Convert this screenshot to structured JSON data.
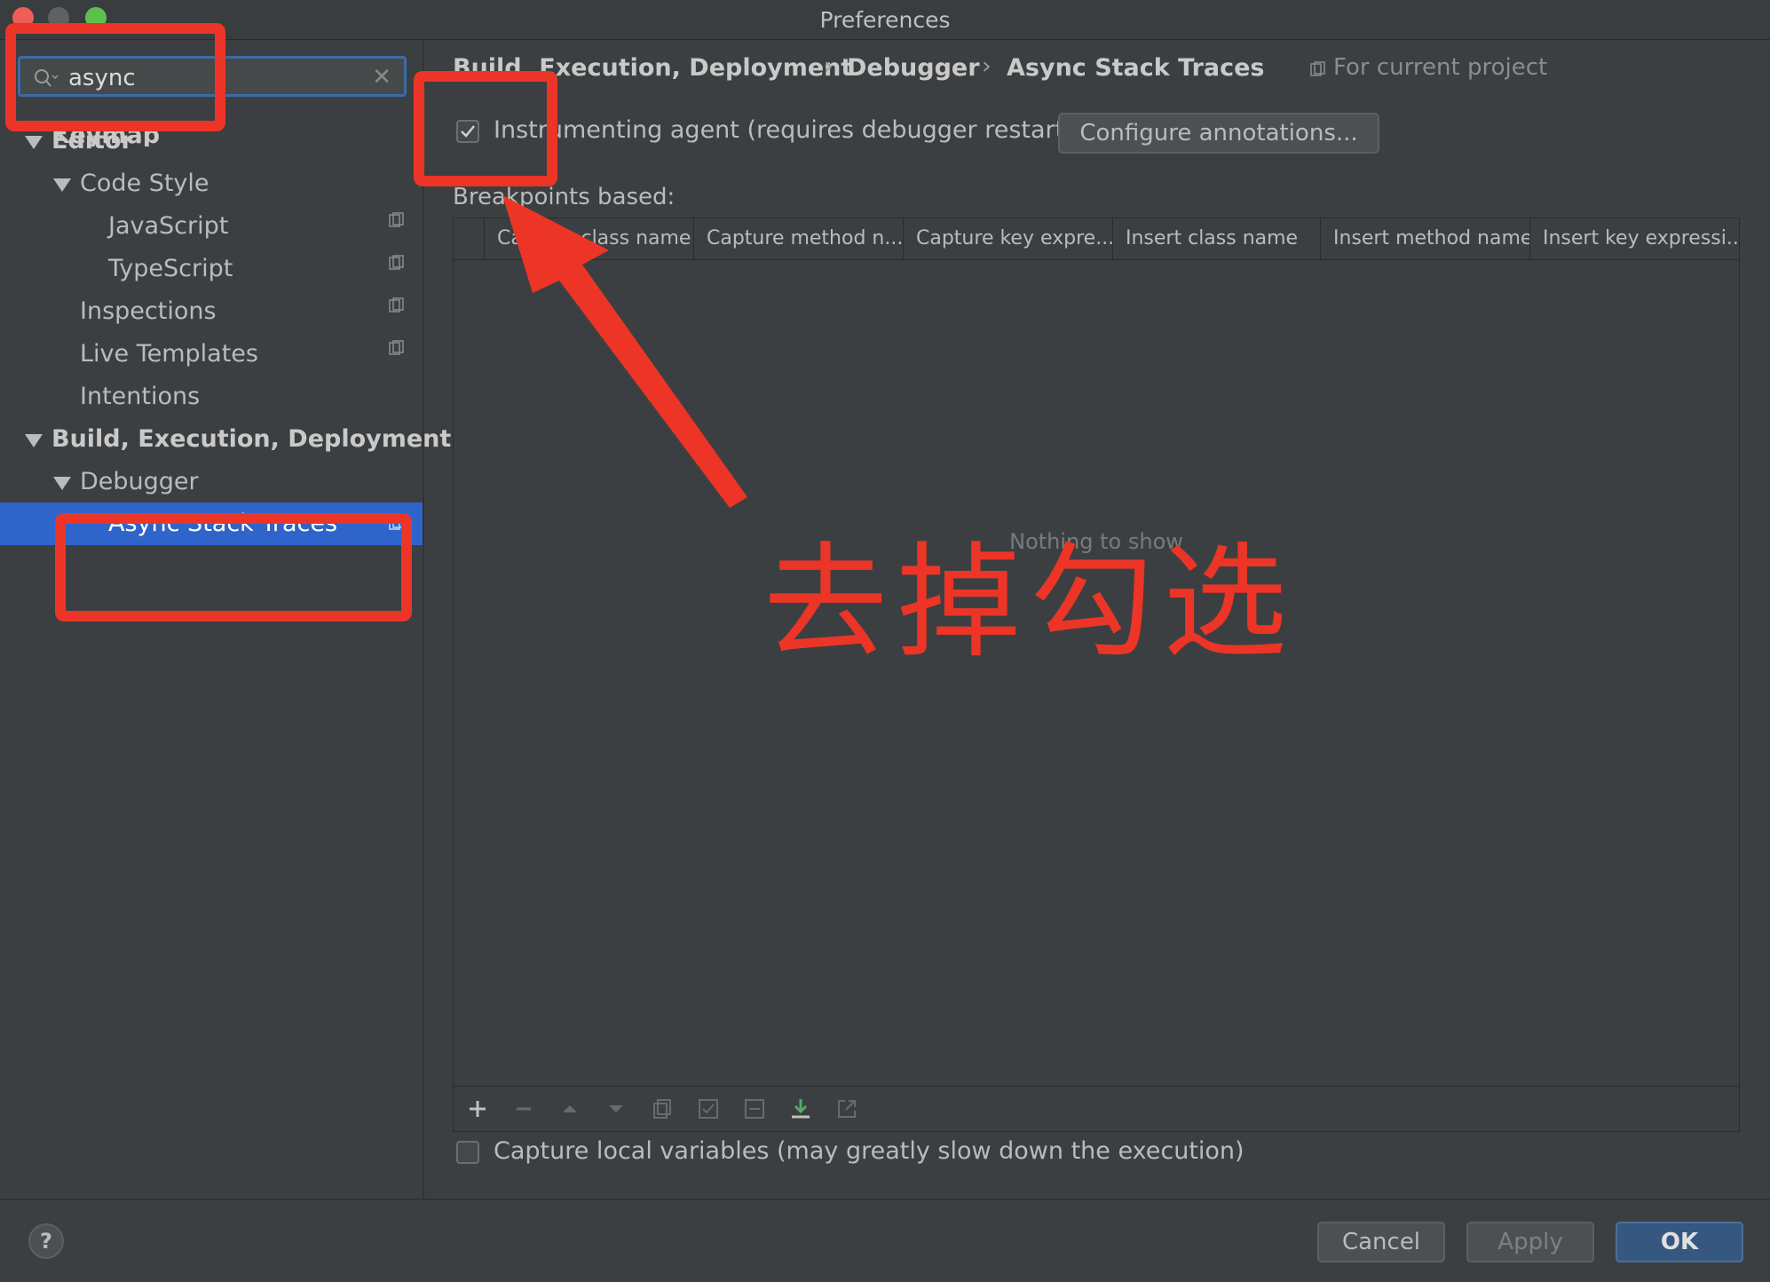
{
  "window": {
    "title": "Preferences"
  },
  "search": {
    "value": "async",
    "clear_glyph": "✕"
  },
  "tree": [
    {
      "label": "Keymap"
    },
    {
      "label": "Editor"
    },
    {
      "label": "Code Style"
    },
    {
      "label": "JavaScript"
    },
    {
      "label": "TypeScript"
    },
    {
      "label": "Inspections"
    },
    {
      "label": "Live Templates"
    },
    {
      "label": "Intentions"
    },
    {
      "label": "Build, Execution, Deployment"
    },
    {
      "label": "Debugger"
    },
    {
      "label": "Async Stack Traces"
    }
  ],
  "breadcrumb": {
    "items": [
      "Build, Execution, Deployment",
      "Debugger",
      "Async Stack Traces"
    ],
    "separator": "›",
    "scope": "For current project"
  },
  "settings": {
    "instrumenting_agent": {
      "label": "Instrumenting agent (requires debugger restart)",
      "checked": true
    },
    "configure_button": "Configure annotations...",
    "breakpoints_label": "Breakpoints based:",
    "columns": [
      "Capture class name",
      "Capture method n...",
      "Capture key expre...",
      "Insert class name",
      "Insert method name",
      "Insert key expressi..."
    ],
    "empty_text": "Nothing to show",
    "capture_local": {
      "label": "Capture local variables (may greatly slow down the execution)",
      "checked": false
    }
  },
  "toolbar_icons": [
    "add-icon",
    "remove-icon",
    "move-up-icon",
    "move-down-icon",
    "copy-icon",
    "check-icon",
    "uncheck-icon",
    "import-icon",
    "export-icon"
  ],
  "footer": {
    "help": "?",
    "cancel": "Cancel",
    "apply": "Apply",
    "ok": "OK"
  },
  "annotation": {
    "text": "去掉勾选"
  },
  "colors": {
    "selection": "#2f65ca",
    "annotation": "#ec3526",
    "ok_button": "#365880"
  }
}
